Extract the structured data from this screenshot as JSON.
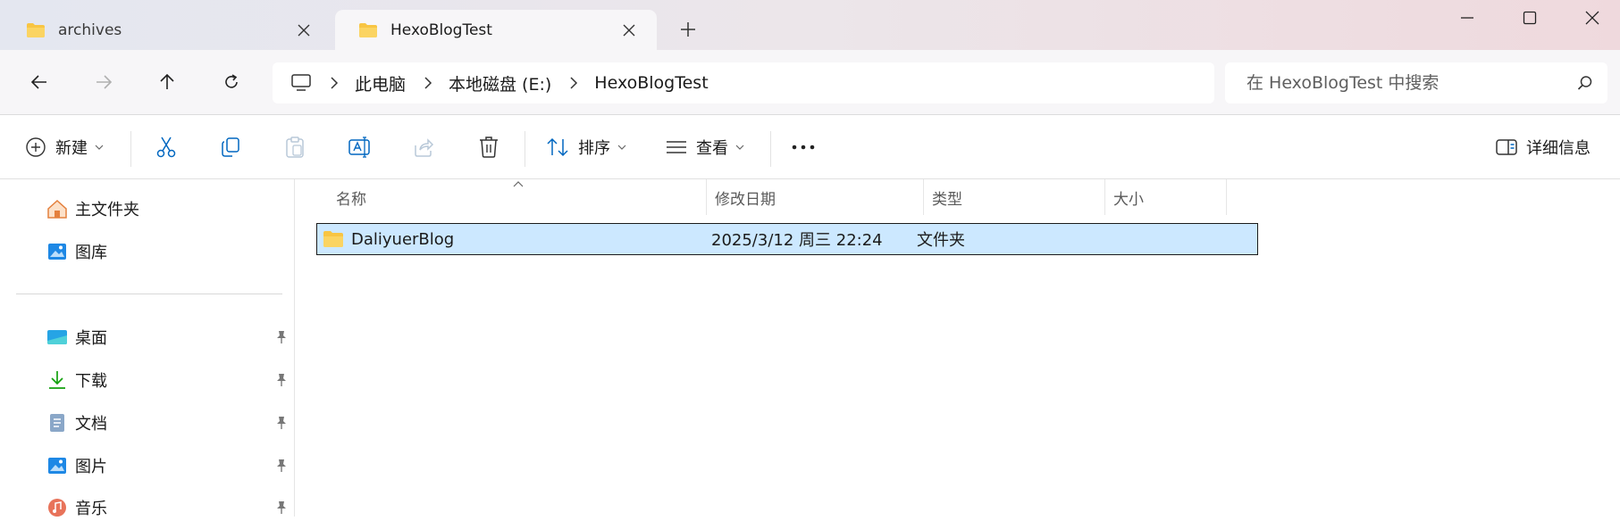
{
  "tabs": [
    {
      "label": "archives",
      "active": false
    },
    {
      "label": "HexoBlogTest",
      "active": true
    }
  ],
  "address": {
    "crumbs": [
      "此电脑",
      "本地磁盘 (E:)",
      "HexoBlogTest"
    ]
  },
  "search": {
    "placeholder": "在 HexoBlogTest 中搜索"
  },
  "toolbar": {
    "new_label": "新建",
    "sort_label": "排序",
    "view_label": "查看",
    "details_label": "详细信息"
  },
  "sidebar": {
    "quick": [
      {
        "label": "主文件夹",
        "icon": "home-icon"
      },
      {
        "label": "图库",
        "icon": "gallery-icon"
      }
    ],
    "pinned": [
      {
        "label": "桌面",
        "icon": "desktop-icon"
      },
      {
        "label": "下载",
        "icon": "download-icon"
      },
      {
        "label": "文档",
        "icon": "document-icon"
      },
      {
        "label": "图片",
        "icon": "pictures-icon"
      },
      {
        "label": "音乐",
        "icon": "music-icon"
      }
    ]
  },
  "columns": [
    "名称",
    "修改日期",
    "类型",
    "大小"
  ],
  "files": [
    {
      "name": "DaliyuerBlog",
      "modified": "2025/3/12 周三 22:24",
      "type": "文件夹",
      "size": "",
      "selected": true
    }
  ],
  "colors": {
    "selection": "#cce8ff",
    "folder": "#f8c543",
    "accent": "#0067c0"
  }
}
